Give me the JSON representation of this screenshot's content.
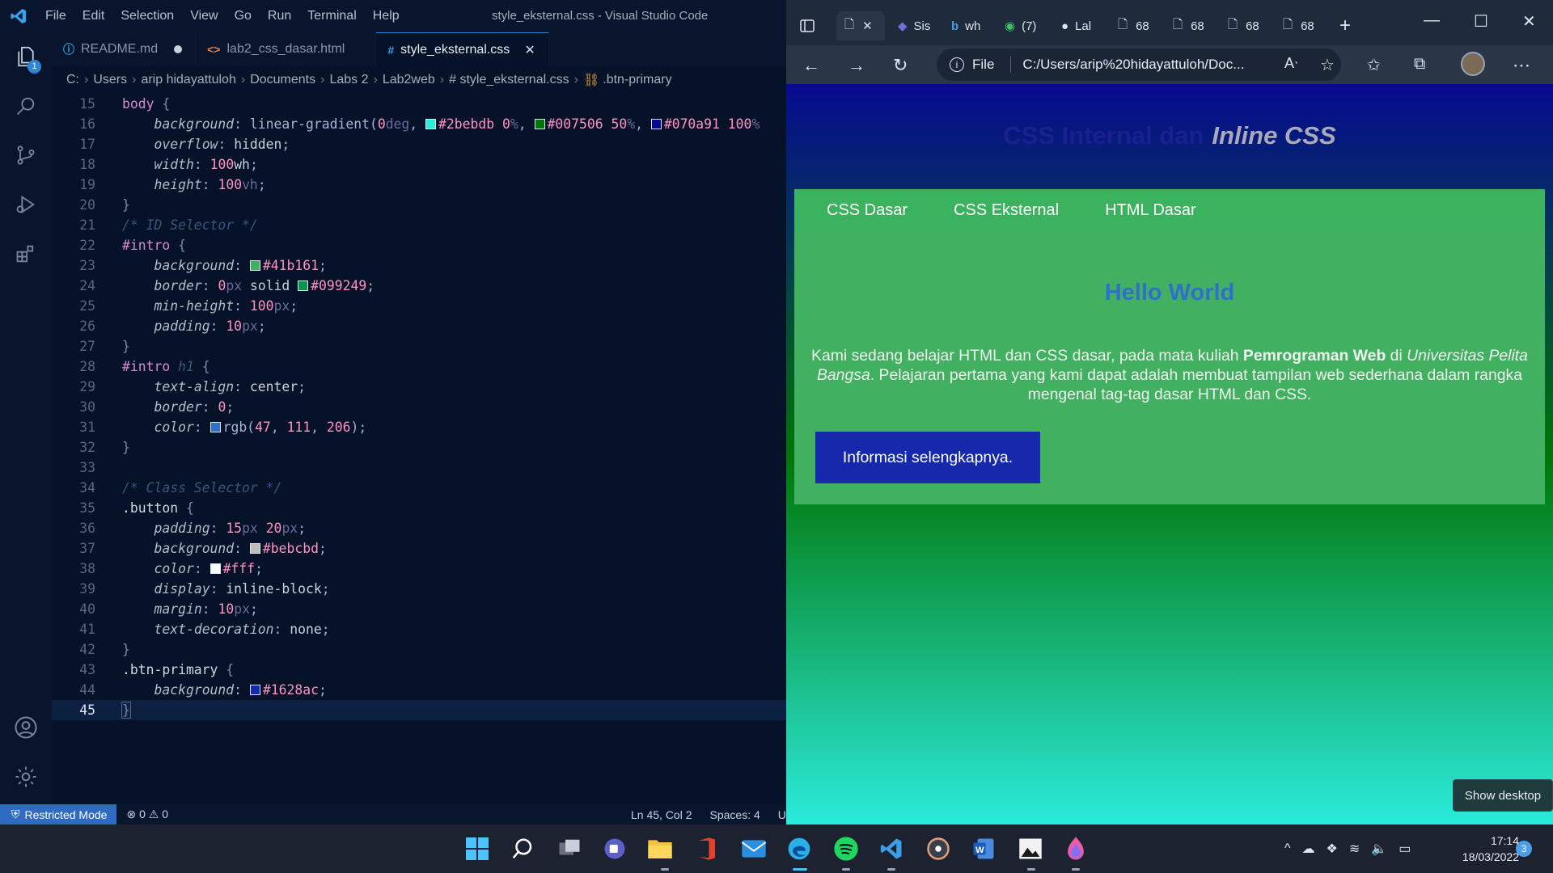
{
  "vscode": {
    "menu": [
      "File",
      "Edit",
      "Selection",
      "View",
      "Go",
      "Run",
      "Terminal",
      "Help"
    ],
    "window_title": "style_eksternal.css - Visual Studio Code",
    "activity_badge": "1",
    "tabs": [
      {
        "label": "README.md",
        "icon": "info-icon",
        "modified": true,
        "active": false
      },
      {
        "label": "lab2_css_dasar.html",
        "icon": "html-icon",
        "modified": false,
        "active": false
      },
      {
        "label": "style_eksternal.css",
        "icon": "css-icon",
        "modified": false,
        "active": true
      }
    ],
    "breadcrumb": [
      "C:",
      "Users",
      "arip hidayattuloh",
      "Documents",
      "Labs 2",
      "Lab2web",
      "# style_eksternal.css",
      ".btn-primary"
    ],
    "line_numbers": [
      "15",
      "16",
      "17",
      "18",
      "19",
      "20",
      "21",
      "22",
      "23",
      "24",
      "25",
      "26",
      "27",
      "28",
      "29",
      "30",
      "31",
      "32",
      "33",
      "34",
      "35",
      "36",
      "37",
      "38",
      "39",
      "40",
      "41",
      "42",
      "43",
      "44",
      "45"
    ],
    "current_line": "45",
    "swatch_colors": {
      "c1": "#2bebdb",
      "c2": "#007506",
      "c3": "#070a91",
      "c4": "#41b161",
      "c5": "#099249",
      "c6": "rgb(47, 111, 206)",
      "c7": "#bebcbd",
      "c8": "#fff",
      "c9": "#1628ac"
    },
    "status": {
      "restricted": "Restricted Mode",
      "errors": "0",
      "warnings": "0",
      "position": "Ln 45, Col 2",
      "spaces": "Spaces: 4",
      "truncated": "U"
    }
  },
  "edge": {
    "tabs": [
      {
        "label": "",
        "icon": "page-icon",
        "active": true
      },
      {
        "label": "Sis",
        "icon": "site-icon"
      },
      {
        "label": "wh",
        "icon": "bing-icon"
      },
      {
        "label": "(7)",
        "icon": "whatsapp-icon"
      },
      {
        "label": "Lal",
        "icon": "github-icon"
      },
      {
        "label": "68",
        "icon": "page-icon"
      },
      {
        "label": "68",
        "icon": "page-icon"
      },
      {
        "label": "68",
        "icon": "page-icon"
      },
      {
        "label": "68",
        "icon": "page-icon"
      }
    ],
    "address": {
      "scheme_label": "File",
      "url": "C:/Users/arip%20hidayattuloh/Doc..."
    },
    "page": {
      "header_plain": "CSS Internal dan",
      "header_em": "Inline CSS",
      "nav": [
        "CSS Dasar",
        "CSS Eksternal",
        "HTML Dasar"
      ],
      "intro_title": "Hello World",
      "intro_text_1": "Kami sedang belajar HTML dan CSS dasar, pada mata kuliah ",
      "intro_text_bold": "Pemrograman Web",
      "intro_text_2": " di ",
      "intro_text_em": "Universitas Pelita Bangsa",
      "intro_text_3": ". Pelajaran pertama yang kami dapat adalah membuat tampilan web sederhana dalam rangka mengenal tag-tag dasar HTML dan CSS.",
      "button_label": "Informasi selengkapnya."
    }
  },
  "show_desktop": "Show desktop",
  "taskbar": {
    "apps": [
      "start-icon",
      "search-icon",
      "task-view-icon",
      "teams-icon",
      "file-explorer-icon",
      "office-icon",
      "mail-icon",
      "edge-icon",
      "spotify-icon",
      "vscode-icon",
      "media-player-icon",
      "word-icon",
      "photos-icon",
      "figma-icon"
    ],
    "time": "17:14",
    "date": "18/03/2022",
    "notifications": "3"
  }
}
